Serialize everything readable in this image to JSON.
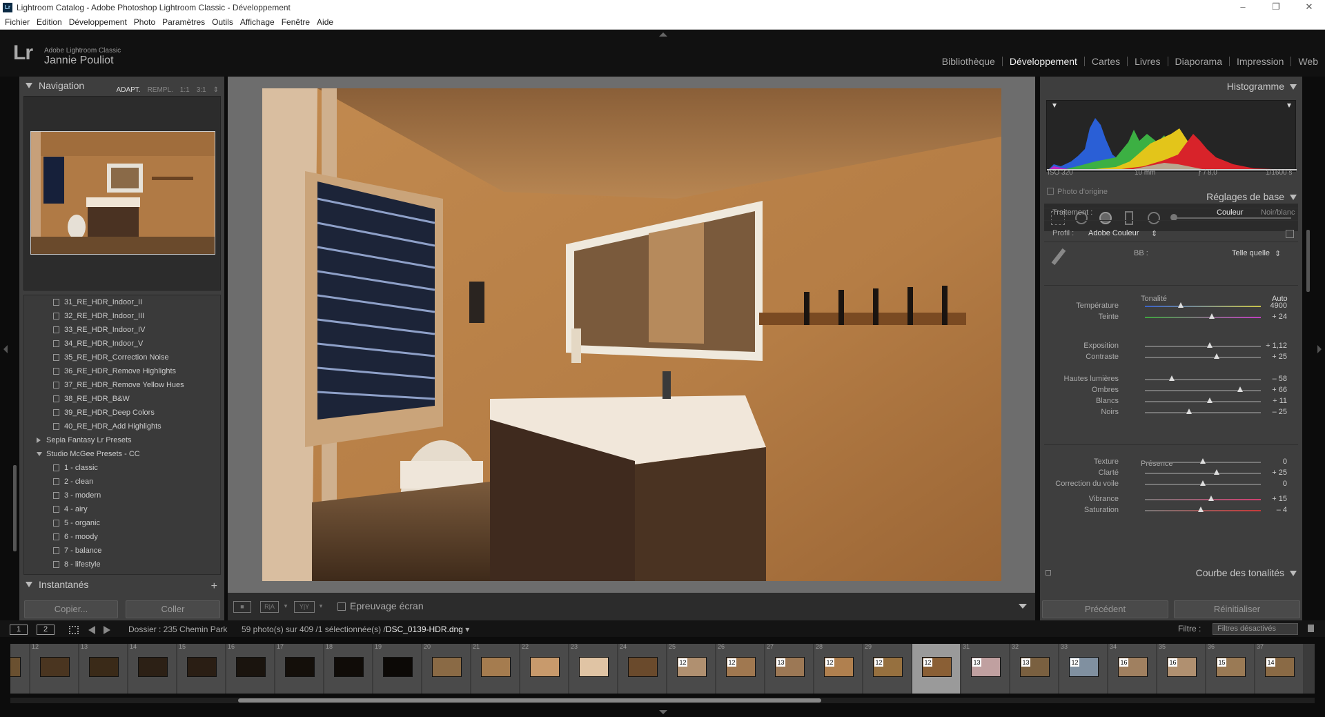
{
  "window": {
    "title": "Lightroom Catalog - Adobe Photoshop Lightroom Classic - Développement",
    "app_icon": "Lr",
    "controls": [
      "minimize-icon",
      "maximize-icon",
      "close-icon"
    ]
  },
  "menu": [
    "Fichier",
    "Edition",
    "Développement",
    "Photo",
    "Paramètres",
    "Outils",
    "Affichage",
    "Fenêtre",
    "Aide"
  ],
  "identity": {
    "logo": "Lr",
    "app_name": "Adobe Lightroom Classic",
    "user": "Jannie Pouliot"
  },
  "modules": [
    {
      "label": "Bibliothèque",
      "active": false
    },
    {
      "label": "Développement",
      "active": true
    },
    {
      "label": "Cartes",
      "active": false
    },
    {
      "label": "Livres",
      "active": false
    },
    {
      "label": "Diaporama",
      "active": false
    },
    {
      "label": "Impression",
      "active": false
    },
    {
      "label": "Web",
      "active": false
    }
  ],
  "navigator": {
    "title": "Navigation",
    "options": [
      "ADAPT.",
      "REMPL.",
      "1:1",
      "3:1"
    ],
    "active_option": "ADAPT."
  },
  "presets": [
    {
      "type": "preset",
      "label": "31_RE_HDR_Indoor_II"
    },
    {
      "type": "preset",
      "label": "32_RE_HDR_Indoor_III"
    },
    {
      "type": "preset",
      "label": "33_RE_HDR_Indoor_IV"
    },
    {
      "type": "preset",
      "label": "34_RE_HDR_Indoor_V"
    },
    {
      "type": "preset",
      "label": "35_RE_HDR_Correction Noise"
    },
    {
      "type": "preset",
      "label": "36_RE_HDR_Remove Highlights"
    },
    {
      "type": "preset",
      "label": "37_RE_HDR_Remove Yellow Hues"
    },
    {
      "type": "preset",
      "label": "38_RE_HDR_B&W"
    },
    {
      "type": "preset",
      "label": "39_RE_HDR_Deep Colors"
    },
    {
      "type": "preset",
      "label": "40_RE_HDR_Add Highlights"
    },
    {
      "type": "group-closed",
      "label": "Sepia Fantasy Lr Presets"
    },
    {
      "type": "group-open",
      "label": "Studio McGee Presets - CC"
    },
    {
      "type": "preset",
      "label": "1 - classic"
    },
    {
      "type": "preset",
      "label": "2 - clean"
    },
    {
      "type": "preset",
      "label": "3 - modern"
    },
    {
      "type": "preset",
      "label": "4 - airy"
    },
    {
      "type": "preset",
      "label": "5 - organic"
    },
    {
      "type": "preset",
      "label": "6 - moody"
    },
    {
      "type": "preset",
      "label": "7 - balance"
    },
    {
      "type": "preset",
      "label": "8 - lifestyle"
    }
  ],
  "snapshots": {
    "title": "Instantanés",
    "add": "+"
  },
  "left_buttons": {
    "copy": "Copier...",
    "paste": "Coller"
  },
  "toolbar": {
    "view_icons": [
      "loupe-view-icon",
      "before-after-ra-icon",
      "before-after-yy-icon"
    ],
    "ra_label": "R|A",
    "yy_label": "Y|Y",
    "soft_proof": "Epreuvage écran"
  },
  "histogram": {
    "title": "Histogramme",
    "iso": "ISO 320",
    "focal": "10 mm",
    "aperture": "ƒ / 8,0",
    "shutter": "1/1600 s",
    "original_photo": "Photo d'origine"
  },
  "basic": {
    "title": "Réglages de base",
    "treatment_label": "Traitement :",
    "treatment_color": "Couleur",
    "treatment_bw": "Noir/blanc",
    "profile_label": "Profil :",
    "profile_value": "Adobe Couleur",
    "wb_label": "BB :",
    "wb_value": "Telle quelle",
    "tone_label": "Tonalité",
    "auto_label": "Auto",
    "presence_label": "Présence",
    "sliders": [
      {
        "label": "Température",
        "value": "4900",
        "pos": 0.31
      },
      {
        "label": "Teinte",
        "value": "+ 24",
        "pos": 0.58
      },
      {
        "label": "Exposition",
        "value": "+ 1,12",
        "pos": 0.56
      },
      {
        "label": "Contraste",
        "value": "+ 25",
        "pos": 0.62
      },
      {
        "label": "Hautes lumières",
        "value": "– 58",
        "pos": 0.23
      },
      {
        "label": "Ombres",
        "value": "+ 66",
        "pos": 0.82
      },
      {
        "label": "Blancs",
        "value": "+ 11",
        "pos": 0.56
      },
      {
        "label": "Noirs",
        "value": "– 25",
        "pos": 0.38
      },
      {
        "label": "Texture",
        "value": "0",
        "pos": 0.5
      },
      {
        "label": "Clarté",
        "value": "+ 25",
        "pos": 0.62
      },
      {
        "label": "Correction du voile",
        "value": "0",
        "pos": 0.5
      },
      {
        "label": "Vibrance",
        "value": "+ 15",
        "pos": 0.57
      },
      {
        "label": "Saturation",
        "value": "– 4",
        "pos": 0.48
      }
    ]
  },
  "tone_curve": {
    "title": "Courbe des tonalités"
  },
  "right_buttons": {
    "previous": "Précédent",
    "reset": "Réinitialiser"
  },
  "filmbar": {
    "page1": "1",
    "page2": "2",
    "folder": "Dossier : 235 Chemin Park",
    "count": "59 photo(s) sur 409 /1 sélectionnée(s) /",
    "filename": "DSC_0139-HDR.dng",
    "filter_label": "Filtre :",
    "filter_value": "Filtres désactivés"
  },
  "filmstrip": [
    {
      "num": "",
      "badge": "",
      "tone": "#6a5030"
    },
    {
      "num": "12",
      "badge": "",
      "tone": "#4a3520"
    },
    {
      "num": "13",
      "badge": "",
      "tone": "#3a2a18"
    },
    {
      "num": "14",
      "badge": "",
      "tone": "#2c2015"
    },
    {
      "num": "15",
      "badge": "",
      "tone": "#2a1e14"
    },
    {
      "num": "16",
      "badge": "",
      "tone": "#1a140e"
    },
    {
      "num": "17",
      "badge": "",
      "tone": "#140f0a"
    },
    {
      "num": "18",
      "badge": "",
      "tone": "#100c08"
    },
    {
      "num": "19",
      "badge": "",
      "tone": "#0c0906"
    },
    {
      "num": "20",
      "badge": "",
      "tone": "#8a6a45"
    },
    {
      "num": "21",
      "badge": "",
      "tone": "#a57c4f"
    },
    {
      "num": "22",
      "badge": "",
      "tone": "#c89a6c"
    },
    {
      "num": "23",
      "badge": "",
      "tone": "#e0c4a4"
    },
    {
      "num": "24",
      "badge": "",
      "tone": "#6a4a2c"
    },
    {
      "num": "25",
      "badge": "12",
      "tone": "#b09070"
    },
    {
      "num": "26",
      "badge": "12",
      "tone": "#a07850"
    },
    {
      "num": "27",
      "badge": "13",
      "tone": "#9c7855"
    },
    {
      "num": "28",
      "badge": "12",
      "tone": "#b0804f"
    },
    {
      "num": "29",
      "badge": "12",
      "tone": "#96703f"
    },
    {
      "num": "30",
      "badge": "12",
      "tone": "#8a5f35"
    },
    {
      "num": "31",
      "badge": "13",
      "tone": "#c0a0a0"
    },
    {
      "num": "32",
      "badge": "13",
      "tone": "#7a6040"
    },
    {
      "num": "33",
      "badge": "12",
      "tone": "#8090a0"
    },
    {
      "num": "34",
      "badge": "16",
      "tone": "#a08060"
    },
    {
      "num": "35",
      "badge": "16",
      "tone": "#b09070"
    },
    {
      "num": "36",
      "badge": "15",
      "tone": "#9a7a55"
    },
    {
      "num": "37",
      "badge": "14",
      "tone": "#8a6a45"
    }
  ],
  "filmstrip_selected_index": 19
}
